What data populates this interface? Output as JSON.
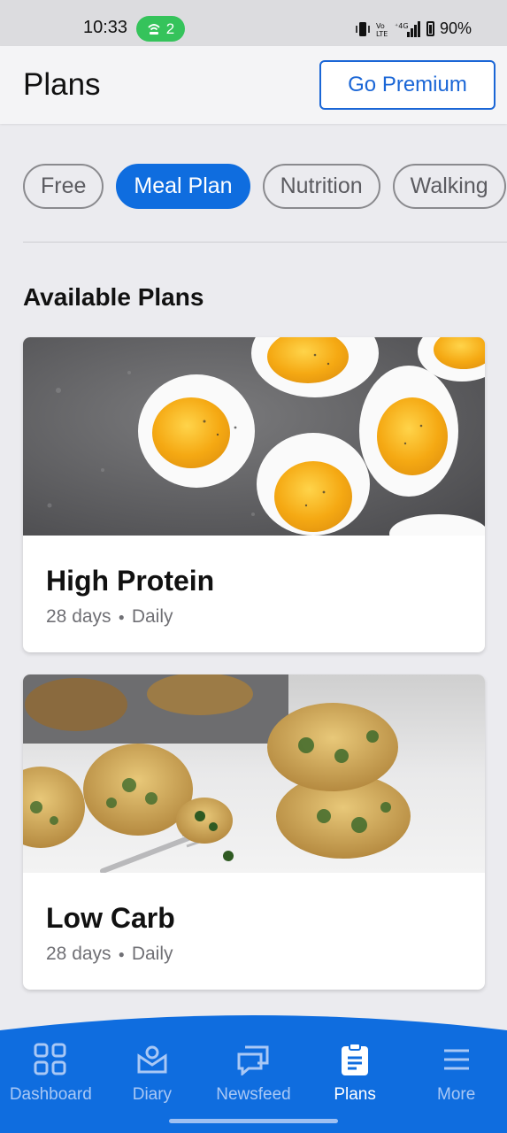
{
  "status_bar": {
    "time": "10:33",
    "hotspot_count": "2",
    "network": "4G",
    "battery": "90%",
    "icons": [
      "vibrate-icon",
      "volte-icon",
      "signal-icon",
      "battery-icon"
    ]
  },
  "header": {
    "title": "Plans",
    "premium_label": "Go Premium"
  },
  "filters": {
    "chips": [
      "Free",
      "Meal Plan",
      "Nutrition",
      "Walking"
    ],
    "selected": "Meal Plan"
  },
  "section": {
    "title": "Available Plans"
  },
  "plans": [
    {
      "title": "High Protein",
      "duration": "28 days",
      "frequency": "Daily",
      "image": "boiled-eggs"
    },
    {
      "title": "Low Carb",
      "duration": "28 days",
      "frequency": "Daily",
      "image": "spinach-egg-muffins"
    }
  ],
  "nav": {
    "items": [
      {
        "label": "Dashboard",
        "icon": "dashboard-icon"
      },
      {
        "label": "Diary",
        "icon": "diary-icon"
      },
      {
        "label": "Newsfeed",
        "icon": "newsfeed-icon"
      },
      {
        "label": "Plans",
        "icon": "plans-icon"
      },
      {
        "label": "More",
        "icon": "menu-icon"
      }
    ],
    "active": "Plans"
  },
  "colors": {
    "primary": "#0f6ddf",
    "premium_border": "#1a66d6",
    "background": "#ebebef",
    "nav_inactive": "#a9c8f5"
  }
}
